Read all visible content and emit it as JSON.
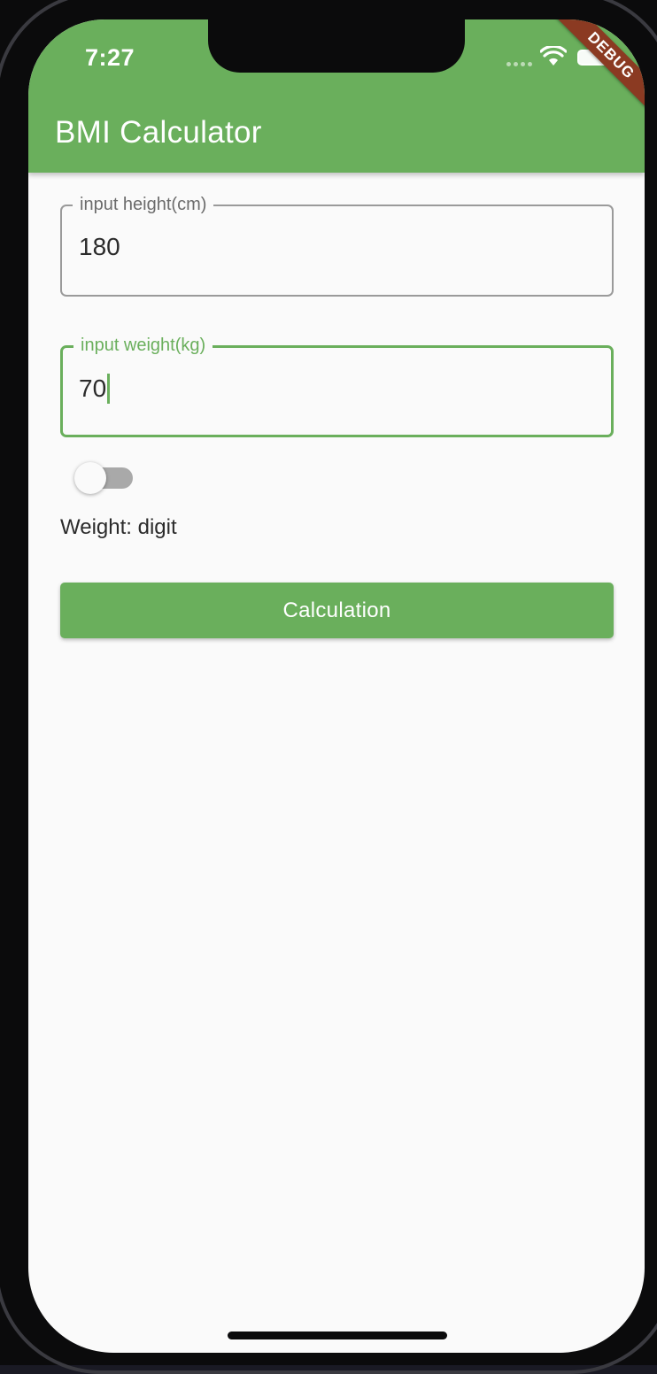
{
  "status_bar": {
    "time": "7:27",
    "debug_banner": "DEBUG"
  },
  "app_bar": {
    "title": "BMI Calculator"
  },
  "form": {
    "height_field": {
      "label": "input height(cm)",
      "value": "180"
    },
    "weight_field": {
      "label": "input weight(kg)",
      "value": "70",
      "focused": true
    },
    "unit_switch": {
      "on": false
    },
    "weight_mode_text": "Weight: digit",
    "calculate_button": "Calculation"
  },
  "colors": {
    "primary": "#6aaf5c",
    "debug_banner": "#8b3a22",
    "background": "#fafafa"
  },
  "icons": [
    "wifi-icon",
    "battery-icon",
    "cellular-signal-icon"
  ]
}
